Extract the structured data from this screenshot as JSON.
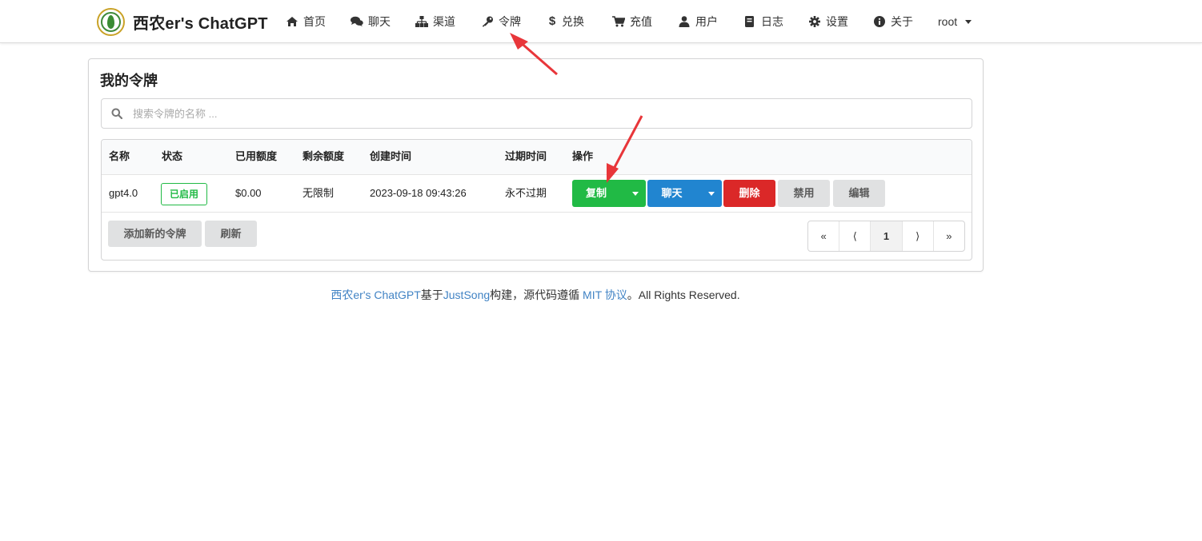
{
  "brand": {
    "name": "西农er's ChatGPT"
  },
  "nav": [
    {
      "label": "首页",
      "icon": "home-icon"
    },
    {
      "label": "聊天",
      "icon": "comments-icon"
    },
    {
      "label": "渠道",
      "icon": "sitemap-icon"
    },
    {
      "label": "令牌",
      "icon": "key-icon"
    },
    {
      "label": "兑换",
      "icon": "dollar-icon"
    },
    {
      "label": "充值",
      "icon": "cart-icon"
    },
    {
      "label": "用户",
      "icon": "user-icon"
    },
    {
      "label": "日志",
      "icon": "book-icon"
    },
    {
      "label": "设置",
      "icon": "gear-icon"
    },
    {
      "label": "关于",
      "icon": "info-icon"
    }
  ],
  "user_menu": {
    "label": "root"
  },
  "card": {
    "title": "我的令牌",
    "search_placeholder": "搜索令牌的名称 ..."
  },
  "table": {
    "headers": [
      "名称",
      "状态",
      "已用额度",
      "剩余额度",
      "创建时间",
      "过期时间",
      "操作"
    ],
    "rows": [
      {
        "name": "gpt4.0",
        "status": "已启用",
        "used": "$0.00",
        "remaining": "无限制",
        "created": "2023-09-18 09:43:26",
        "expires": "永不过期"
      }
    ],
    "actions": {
      "copy": "复制",
      "chat": "聊天",
      "delete": "删除",
      "disable": "禁用",
      "edit": "编辑"
    }
  },
  "footer_buttons": {
    "add": "添加新的令牌",
    "refresh": "刷新"
  },
  "pagination": [
    "«",
    "⟨",
    "1",
    "⟩",
    "»"
  ],
  "footer": {
    "brand_link": "西农er's ChatGPT",
    "text1": "基于",
    "author_link": "JustSong",
    "text2": "构建，源代码遵循 ",
    "license_link": "MIT 协议",
    "text3": "。All Rights Reserved."
  },
  "colors": {
    "green": "#21ba45",
    "blue": "#2185d0",
    "red": "#db2828",
    "link": "#4183c4",
    "annotation_arrow": "#e8363a"
  }
}
